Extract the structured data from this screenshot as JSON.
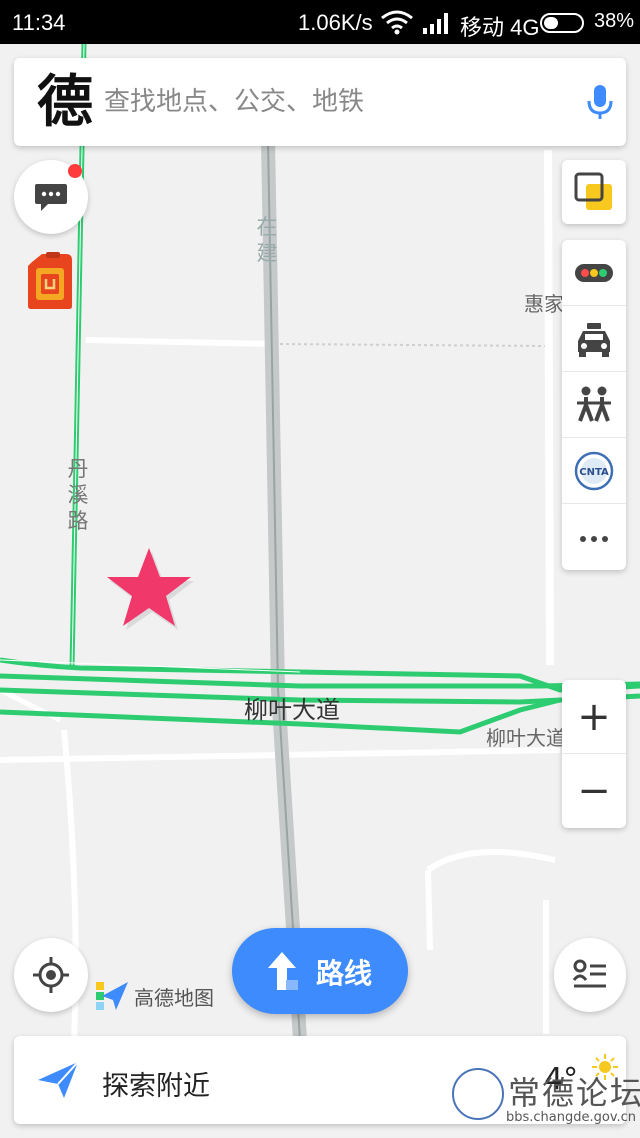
{
  "status_bar": {
    "time": "11:34",
    "network_speed": "1.06K/s",
    "carrier": "移动 4G",
    "battery_percent": "38%",
    "battery_level": 0.38
  },
  "search": {
    "logo_char": "德",
    "placeholder": "查找地点、公交、地铁"
  },
  "map": {
    "road_labels": {
      "danxi_road": [
        "丹",
        "溪",
        "路"
      ],
      "liuye_avenue_main": "柳叶大道",
      "liuye_avenue_side": "柳叶大道",
      "under_construction": [
        "在",
        "建"
      ],
      "huijia": "惠家"
    },
    "colors": {
      "congestion_free": "#2ecc71",
      "favorite_star": "#f0386b"
    }
  },
  "right_toolbar": {
    "items": [
      {
        "name": "traffic",
        "icon": "traffic-light-icon"
      },
      {
        "name": "taxi",
        "icon": "taxi-icon"
      },
      {
        "name": "people",
        "icon": "people-icon"
      },
      {
        "name": "tourism",
        "icon": "cnta-badge-icon",
        "badge_text": "CNTA"
      },
      {
        "name": "more",
        "icon": "more-dots-icon"
      }
    ]
  },
  "zoom": {
    "in_label": "+",
    "out_label": "−"
  },
  "brand": {
    "name": "高德地图"
  },
  "route_button": {
    "label": "路线"
  },
  "nearby": {
    "label": "探索附近",
    "temperature": "4°"
  },
  "watermark": {
    "title": "常德论坛",
    "url": "bbs.changde.gov.cn"
  }
}
